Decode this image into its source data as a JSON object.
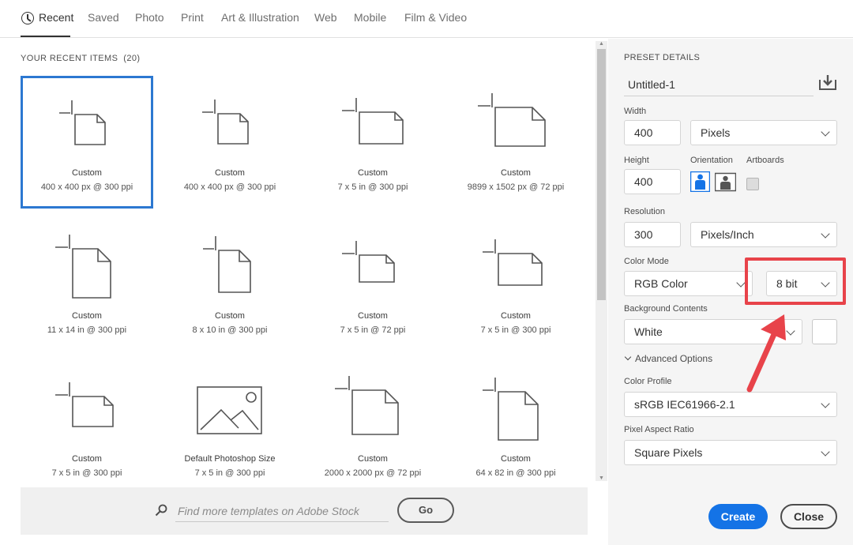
{
  "tabs": [
    {
      "label": "Recent",
      "active": true
    },
    {
      "label": "Saved"
    },
    {
      "label": "Photo"
    },
    {
      "label": "Print"
    },
    {
      "label": "Art & Illustration"
    },
    {
      "label": "Web"
    },
    {
      "label": "Mobile"
    },
    {
      "label": "Film & Video"
    }
  ],
  "recent": {
    "title": "YOUR RECENT ITEMS",
    "count": "(20)",
    "items": [
      {
        "name": "Custom",
        "size": "400 x 400 px @ 300 ppi",
        "icon": "square-document-icon",
        "selected": true
      },
      {
        "name": "Custom",
        "size": "400 x 400 px @ 300 ppi",
        "icon": "square-document-icon"
      },
      {
        "name": "Custom",
        "size": "7 x 5 in @ 300 ppi",
        "icon": "landscape-document-icon"
      },
      {
        "name": "Custom",
        "size": "9899 x 1502 px @ 72 ppi",
        "icon": "wide-document-icon"
      },
      {
        "name": "Custom",
        "size": "11 x 14 in @ 300 ppi",
        "icon": "portrait-document-icon"
      },
      {
        "name": "Custom",
        "size": "8 x 10 in @ 300 ppi",
        "icon": "portrait-document-icon"
      },
      {
        "name": "Custom",
        "size": "7 x 5 in @ 72 ppi",
        "icon": "landscape-document-icon"
      },
      {
        "name": "Custom",
        "size": "7 x 5 in @ 300 ppi",
        "icon": "landscape-document-icon"
      },
      {
        "name": "Custom",
        "size": "7 x 5 in @ 300 ppi",
        "icon": "landscape-document-icon"
      },
      {
        "name": "Default Photoshop Size",
        "size": "7 x 5 in @ 300 ppi",
        "icon": "image-placeholder-icon"
      },
      {
        "name": "Custom",
        "size": "2000 x 2000 px @ 72 ppi",
        "icon": "square-document-icon"
      },
      {
        "name": "Custom",
        "size": "64 x 82 in @ 300 ppi",
        "icon": "portrait-document-icon"
      }
    ]
  },
  "search": {
    "placeholder": "Find more templates on Adobe Stock",
    "go_label": "Go"
  },
  "preset": {
    "title": "PRESET DETAILS",
    "name": "Untitled-1",
    "width_label": "Width",
    "width_value": "400",
    "width_unit": "Pixels",
    "height_label": "Height",
    "height_value": "400",
    "orientation_label": "Orientation",
    "artboards_label": "Artboards",
    "resolution_label": "Resolution",
    "resolution_value": "300",
    "resolution_unit": "Pixels/Inch",
    "color_mode_label": "Color Mode",
    "color_mode": "RGB Color",
    "bit_depth": "8 bit",
    "background_label": "Background Contents",
    "background": "White",
    "advanced_label": "Advanced Options",
    "color_profile_label": "Color Profile",
    "color_profile": "sRGB IEC61966-2.1",
    "pixel_aspect_label": "Pixel Aspect Ratio",
    "pixel_aspect": "Square Pixels",
    "create_label": "Create",
    "close_label": "Close"
  },
  "colors": {
    "accent": "#1473e6",
    "selection": "#2c78d1",
    "annotation": "#e8434a"
  }
}
